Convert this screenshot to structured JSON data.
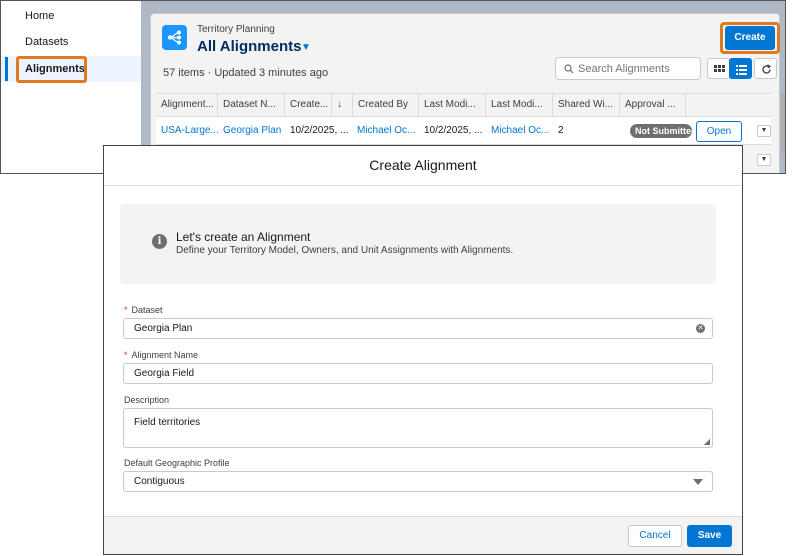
{
  "nav": {
    "items": [
      {
        "label": "Home"
      },
      {
        "label": "Datasets"
      },
      {
        "label": "Alignments"
      }
    ]
  },
  "list": {
    "eyebrow": "Territory Planning",
    "title": "All Alignments",
    "meta": "57 items · Updated 3 minutes ago",
    "create_label": "Create",
    "search_placeholder": "Search Alignments",
    "columns": [
      "Alignment...",
      "Dataset N...",
      "Create...",
      "Created By",
      "Last Modi...",
      "Last Modi...",
      "Shared Wi...",
      "Approval ..."
    ],
    "sort_indicator": "↓",
    "row": {
      "alignment": "USA-Large...",
      "dataset": "Georgia Plan",
      "created": "10/2/2025, ...",
      "created_by": "Michael Oc...",
      "last_modified": "10/2/2025, ...",
      "last_modified_by": "Michael Oc...",
      "shared_with": "2",
      "approval": "Not Submitted",
      "open_label": "Open"
    }
  },
  "modal": {
    "title": "Create Alignment",
    "info_title": "Let's create an Alignment",
    "info_desc": "Define your Territory Model, Owners, and Unit Assignments with Alignments.",
    "dataset_label": "Dataset",
    "dataset_value": "Georgia Plan",
    "name_label": "Alignment Name",
    "name_value": "Georgia Field",
    "description_label": "Description",
    "description_value": "Field territories",
    "geo_label": "Default Geographic Profile",
    "geo_value": "Contiguous",
    "required_mark": "*",
    "cancel_label": "Cancel",
    "save_label": "Save"
  },
  "colors": {
    "brand": "#0176d3",
    "highlight": "#e07a1f",
    "status_pill": "#706e6b"
  }
}
